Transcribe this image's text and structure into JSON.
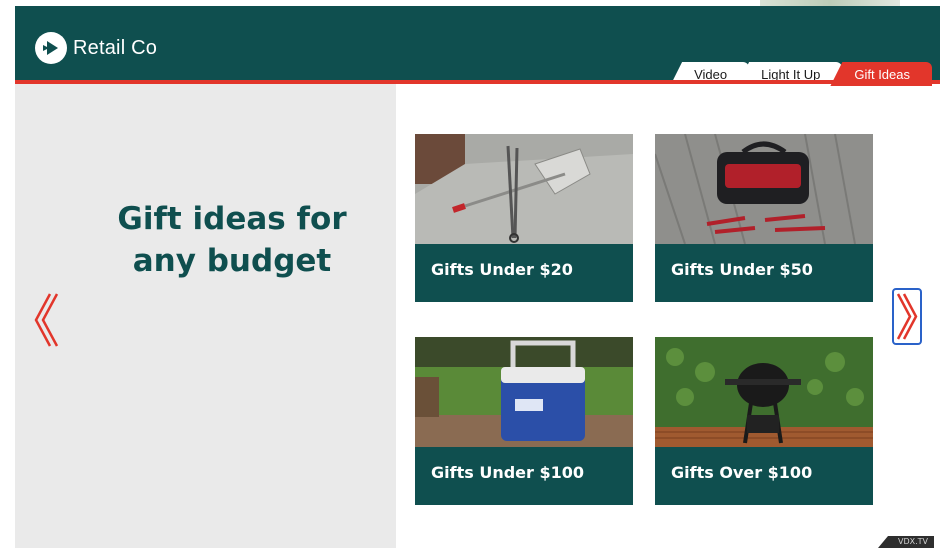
{
  "brand": {
    "name": "Retail Co",
    "logo_icon": "play-circle-icon"
  },
  "tabs": [
    {
      "label": "Video",
      "active": false
    },
    {
      "label": "Light It Up",
      "active": false
    },
    {
      "label": "Gift Ideas",
      "active": true
    }
  ],
  "hero": {
    "headline_line1": "Gift ideas for",
    "headline_line2": "any budget"
  },
  "cards": [
    {
      "label": "Gifts Under $20",
      "image": "bbq-tongs-and-spatula"
    },
    {
      "label": "Gifts Under $50",
      "image": "tool-bag-and-screwdrivers"
    },
    {
      "label": "Gifts Under $100",
      "image": "esky-cooler"
    },
    {
      "label": "Gifts Over $100",
      "image": "kettle-bbq-grill"
    }
  ],
  "navigation": {
    "prev_icon": "chevron-left-icon",
    "next_icon": "chevron-right-icon"
  },
  "colors": {
    "brand_teal": "#0f4f4f",
    "accent_red": "#e2362b",
    "focus_blue": "#2a62c9",
    "panel_grey": "#eaeaea"
  },
  "watermark": "VDX.TV"
}
